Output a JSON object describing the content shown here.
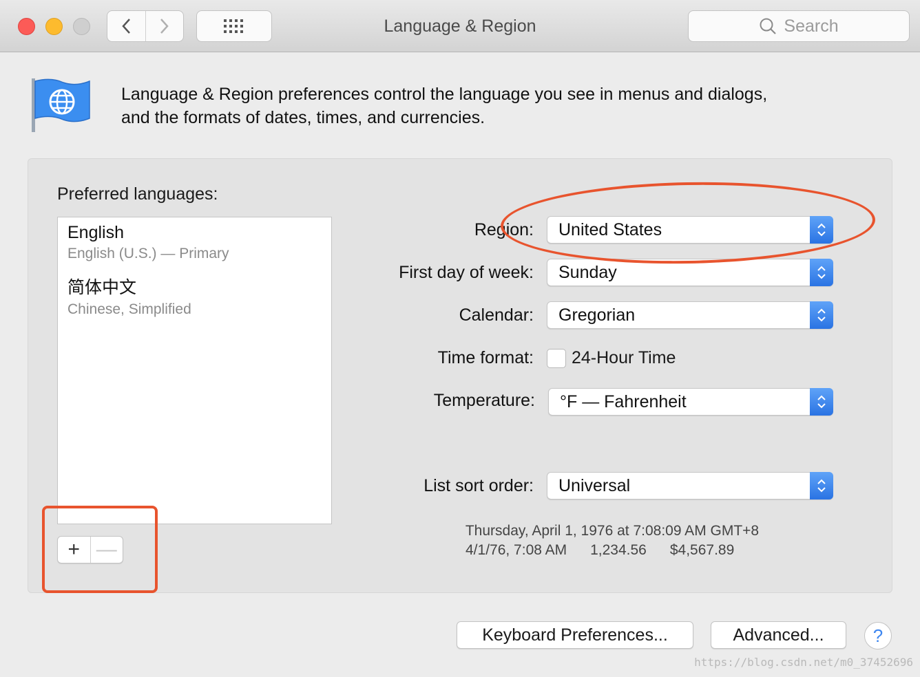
{
  "window": {
    "title": "Language & Region",
    "search_placeholder": "Search"
  },
  "header": {
    "description_line1": "Language & Region preferences control the language you see in menus and dialogs,",
    "description_line2": "and the formats of dates, times, and currencies."
  },
  "languages": {
    "label": "Preferred languages:",
    "items": [
      {
        "name": "English",
        "detail": "English (U.S.) — Primary"
      },
      {
        "name": "简体中文",
        "detail": "Chinese, Simplified"
      }
    ],
    "add_symbol": "+",
    "remove_symbol": "—"
  },
  "settings": {
    "region_label": "Region:",
    "region_value": "United States",
    "first_day_label": "First day of week:",
    "first_day_value": "Sunday",
    "calendar_label": "Calendar:",
    "calendar_value": "Gregorian",
    "time_format_label": "Time format:",
    "time_format_option": "24-Hour Time",
    "temperature_label": "Temperature:",
    "temperature_value": "°F — Fahrenheit",
    "sort_label": "List sort order:",
    "sort_value": "Universal"
  },
  "sample": {
    "long_date": "Thursday, April 1, 1976 at 7:08:09 AM GMT+8",
    "short_date": "4/1/76, 7:08 AM",
    "number": "1,234.56",
    "currency": "$4,567.89"
  },
  "buttons": {
    "keyboard": "Keyboard Preferences...",
    "advanced": "Advanced...",
    "help": "?"
  },
  "watermark": "https://blog.csdn.net/m0_37452696",
  "colors": {
    "accent": "#2a73e3",
    "annotation": "#e8542e"
  }
}
